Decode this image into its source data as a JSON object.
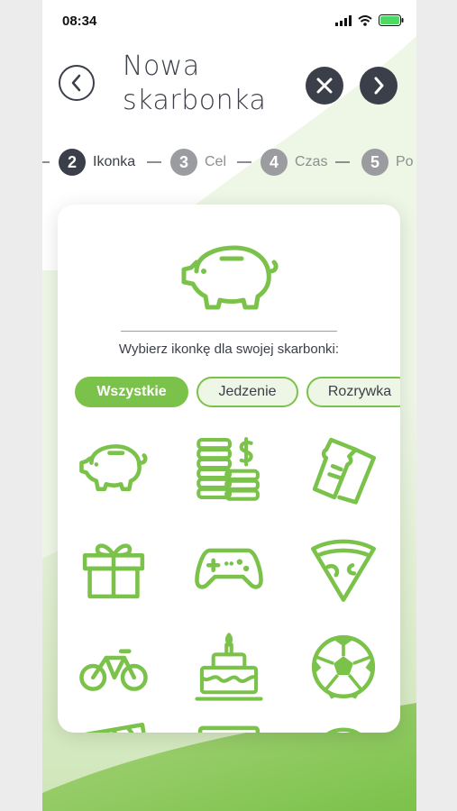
{
  "status_bar": {
    "time": "08:34"
  },
  "header": {
    "title_line1": "Nowa",
    "title_line2": "skarbonka"
  },
  "stepper": {
    "steps": [
      {
        "number": "2",
        "label": "Ikonka"
      },
      {
        "number": "3",
        "label": "Cel"
      },
      {
        "number": "4",
        "label": "Czas"
      },
      {
        "number": "5",
        "label": "Po"
      }
    ]
  },
  "picker": {
    "prompt": "Wybierz ikonkę dla swojej skarbonki:",
    "categories": [
      "Wszystkie",
      "Jedzenie",
      "Rozrywka"
    ],
    "selected_category": "Wszystkie",
    "icons": [
      "piggy-bank-icon",
      "coins-icon",
      "tickets-icon",
      "gift-icon",
      "gamepad-icon",
      "pizza-icon",
      "bicycle-icon",
      "cake-icon",
      "soccer-ball-icon"
    ]
  },
  "colors": {
    "accent": "#7bc24a",
    "dark": "#3b3f49",
    "inactive": "#9a9ca0"
  }
}
